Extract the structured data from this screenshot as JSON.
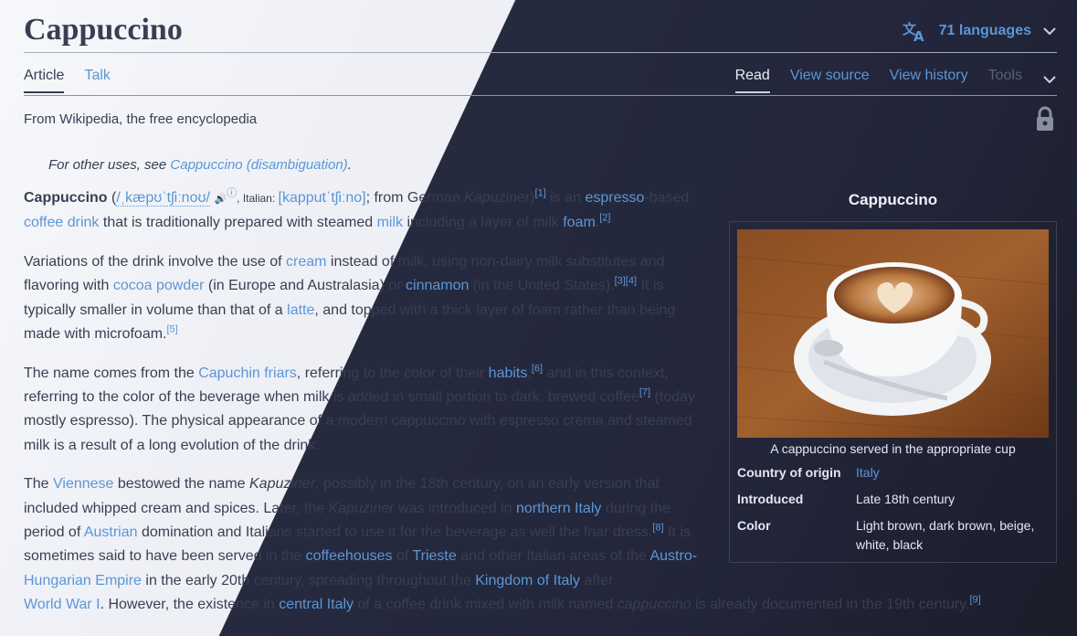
{
  "page": {
    "title": "Cappuccino",
    "languages_label": "71 languages",
    "tagline": "From Wikipedia, the free encyclopedia"
  },
  "tabs_left": {
    "article": "Article",
    "talk": "Talk"
  },
  "tabs_right": {
    "read": "Read",
    "view_source": "View source",
    "view_history": "View history",
    "tools": "Tools"
  },
  "hatnote": {
    "prefix": "For other uses, see ",
    "link": "Cappuccino (disambiguation)",
    "suffix": "."
  },
  "intro": {
    "bold": "Cappuccino",
    "open_paren": " (",
    "ipa_en": "/ˌkæpʊˈtʃiːnoʊ/",
    "speaker_glyph": "🔊",
    "info_glyph": "ⓘ",
    "italian_label": ", Italian: ",
    "ipa_it": "[kapputˈtʃiːno]",
    "from_german": "; from German ",
    "kapuziner": "Kapuziner",
    "close_paren": ")",
    "ref1": "[1]",
    "is_an": " is an ",
    "espresso_link": "espresso",
    "based": "-based ",
    "coffee_drink": "coffee drink",
    "trad": " that is traditionally prepared with steamed ",
    "milk": "milk",
    "layer": " including a layer of milk ",
    "foam": "foam",
    "dot": ".",
    "ref2": "[2]"
  },
  "p2": {
    "t1": "Variations of the drink involve the use of ",
    "cream": "cream",
    "t2": " instead of milk, using non-dairy milk substitutes and flavoring with ",
    "cocoa": "cocoa powder",
    "t3": " (in Europe and Australasia) or ",
    "cinnamon": "cinnamon",
    "t4": " (in the United States).",
    "ref34": "[3][4]",
    "t5": " It is typically smaller in volume than that of a ",
    "latte": "latte",
    "t6": ", and topped with a thick layer of foam rather than being made with microfoam.",
    "ref5": "[5]"
  },
  "p3": {
    "t1": "The name comes from the ",
    "capuchin": "Capuchin friars",
    "t2": ", referring to the color of their ",
    "habits": "habits",
    "t3": ",",
    "ref6": "[6]",
    "t4": " and in this context, referring to the color of the beverage when milk is added in small portion to dark, brewed coffee",
    "ref7": "[7]",
    "t5": " (today mostly espresso). The physical appearance of a modern cappuccino with espresso crema and steamed milk is a result of a long evolution of the drink."
  },
  "p4": {
    "t1": "The ",
    "viennese": "Viennese",
    "t2": " bestowed the name ",
    "kap1": "Kapuziner",
    "t3": ", possibly in the 18th century, on an early version that included whipped cream and spices. Later, the ",
    "kap2": "Kapuziner",
    "t4": " was introduced in ",
    "northern_italy": "northern Italy",
    "t5": " during the period of ",
    "austrian": "Austrian",
    "t6": " domination and Italians started to use it for the beverage as well the friar dress.",
    "ref8": "[8]",
    "t7": " It is sometimes said to have been served in the ",
    "coffeehouses": "coffeehouses",
    "t8": " of ",
    "trieste": "Trieste",
    "t9": " and other Italian areas of the ",
    "austro": "Austro-Hungarian Empire",
    "t10": " in the early 20th century, spreading throughout the ",
    "kingdom": "Kingdom of Italy",
    "t11": " after ",
    "ww1": "World War I",
    "t12": ". However, the existence in ",
    "central_italy": "central Italy",
    "t13": " of a coffee drink mixed with milk named ",
    "cappuccino_it": "cappuccino",
    "t14": " is already documented in the 19th century.",
    "ref9": "[9]"
  },
  "infobox": {
    "title": "Cappuccino",
    "caption": "A cappuccino served in the appropriate cup",
    "rows": [
      {
        "label": "Country of origin",
        "value": "Italy",
        "is_link": true
      },
      {
        "label": "Introduced",
        "value": "Late 18th century",
        "is_link": false
      },
      {
        "label": "Color",
        "value": "Light brown, dark brown, beige, white, black",
        "is_link": false
      }
    ]
  },
  "icons": {
    "language": "language-icon",
    "chevron": "chevron-down-icon",
    "lock": "lock-icon"
  },
  "colors": {
    "link": "#5b96d6",
    "text_light": "#3a3e52",
    "text_dark": "#e5e8f1"
  }
}
